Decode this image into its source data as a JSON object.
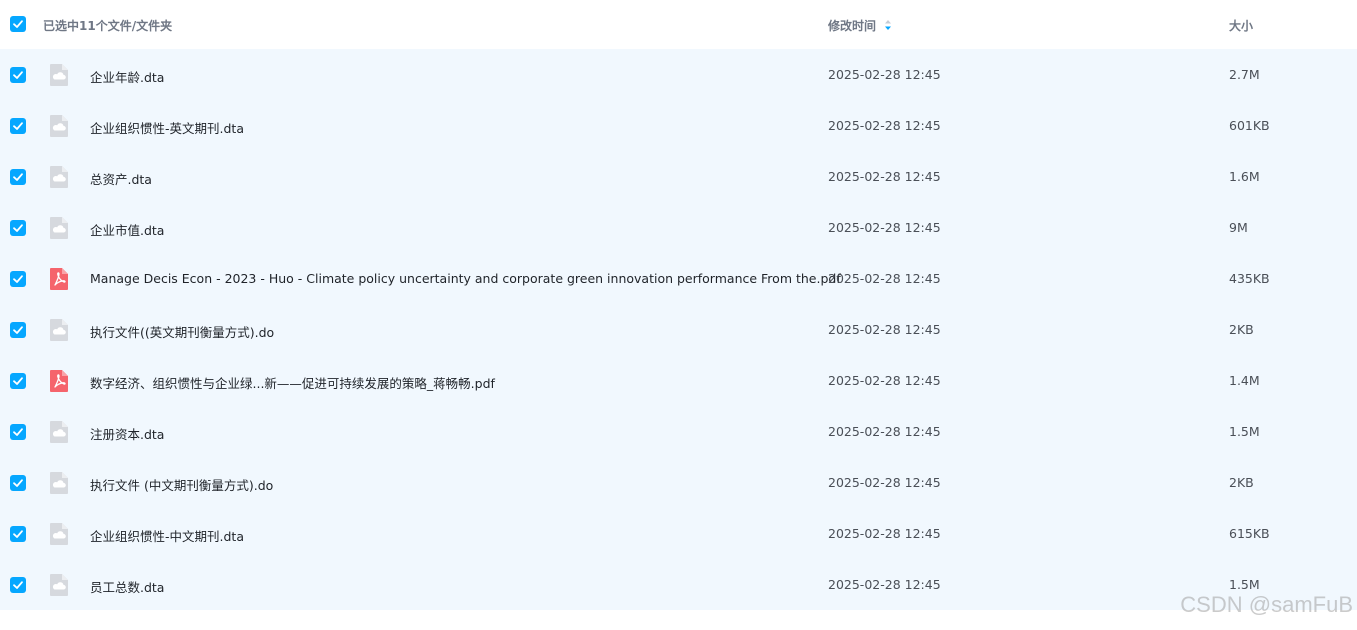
{
  "header": {
    "selection_text": "已选中11个文件/文件夹",
    "col_modified": "修改时间",
    "col_size": "大小",
    "sort_icon": "sort-desc-icon"
  },
  "files": [
    {
      "name": "企业年龄.dta",
      "date": "2025-02-28 12:45",
      "size": "2.7M",
      "icon": "generic-file-icon",
      "checked": true
    },
    {
      "name": "企业组织惯性-英文期刊.dta",
      "date": "2025-02-28 12:45",
      "size": "601KB",
      "icon": "generic-file-icon",
      "checked": true
    },
    {
      "name": "总资产.dta",
      "date": "2025-02-28 12:45",
      "size": "1.6M",
      "icon": "generic-file-icon",
      "checked": true
    },
    {
      "name": "企业市值.dta",
      "date": "2025-02-28 12:45",
      "size": "9M",
      "icon": "generic-file-icon",
      "checked": true
    },
    {
      "name": "Manage Decis Econ - 2023 - Huo - Climate policy uncertainty and corporate green innovation performance From the.pdf",
      "date": "2025-02-28 12:45",
      "size": "435KB",
      "icon": "pdf-file-icon",
      "checked": true
    },
    {
      "name": "执行文件((英文期刊衡量方式).do",
      "date": "2025-02-28 12:45",
      "size": "2KB",
      "icon": "generic-file-icon",
      "checked": true
    },
    {
      "name": "数字经济、组织惯性与企业绿...新——促进可持续发展的策略_蒋畅畅.pdf",
      "date": "2025-02-28 12:45",
      "size": "1.4M",
      "icon": "pdf-file-icon",
      "checked": true
    },
    {
      "name": "注册资本.dta",
      "date": "2025-02-28 12:45",
      "size": "1.5M",
      "icon": "generic-file-icon",
      "checked": true
    },
    {
      "name": "执行文件 (中文期刊衡量方式).do",
      "date": "2025-02-28 12:45",
      "size": "2KB",
      "icon": "generic-file-icon",
      "checked": true
    },
    {
      "name": "企业组织惯性-中文期刊.dta",
      "date": "2025-02-28 12:45",
      "size": "615KB",
      "icon": "generic-file-icon",
      "checked": true
    },
    {
      "name": "员工总数.dta",
      "date": "2025-02-28 12:45",
      "size": "1.5M",
      "icon": "generic-file-icon",
      "checked": true
    }
  ],
  "watermark": "CSDN @samFuB",
  "colors": {
    "accent": "#06a7ff",
    "row_bg": "#f1f8fe",
    "pdf_red": "#f5646c",
    "file_gray": "#d6d9de"
  }
}
